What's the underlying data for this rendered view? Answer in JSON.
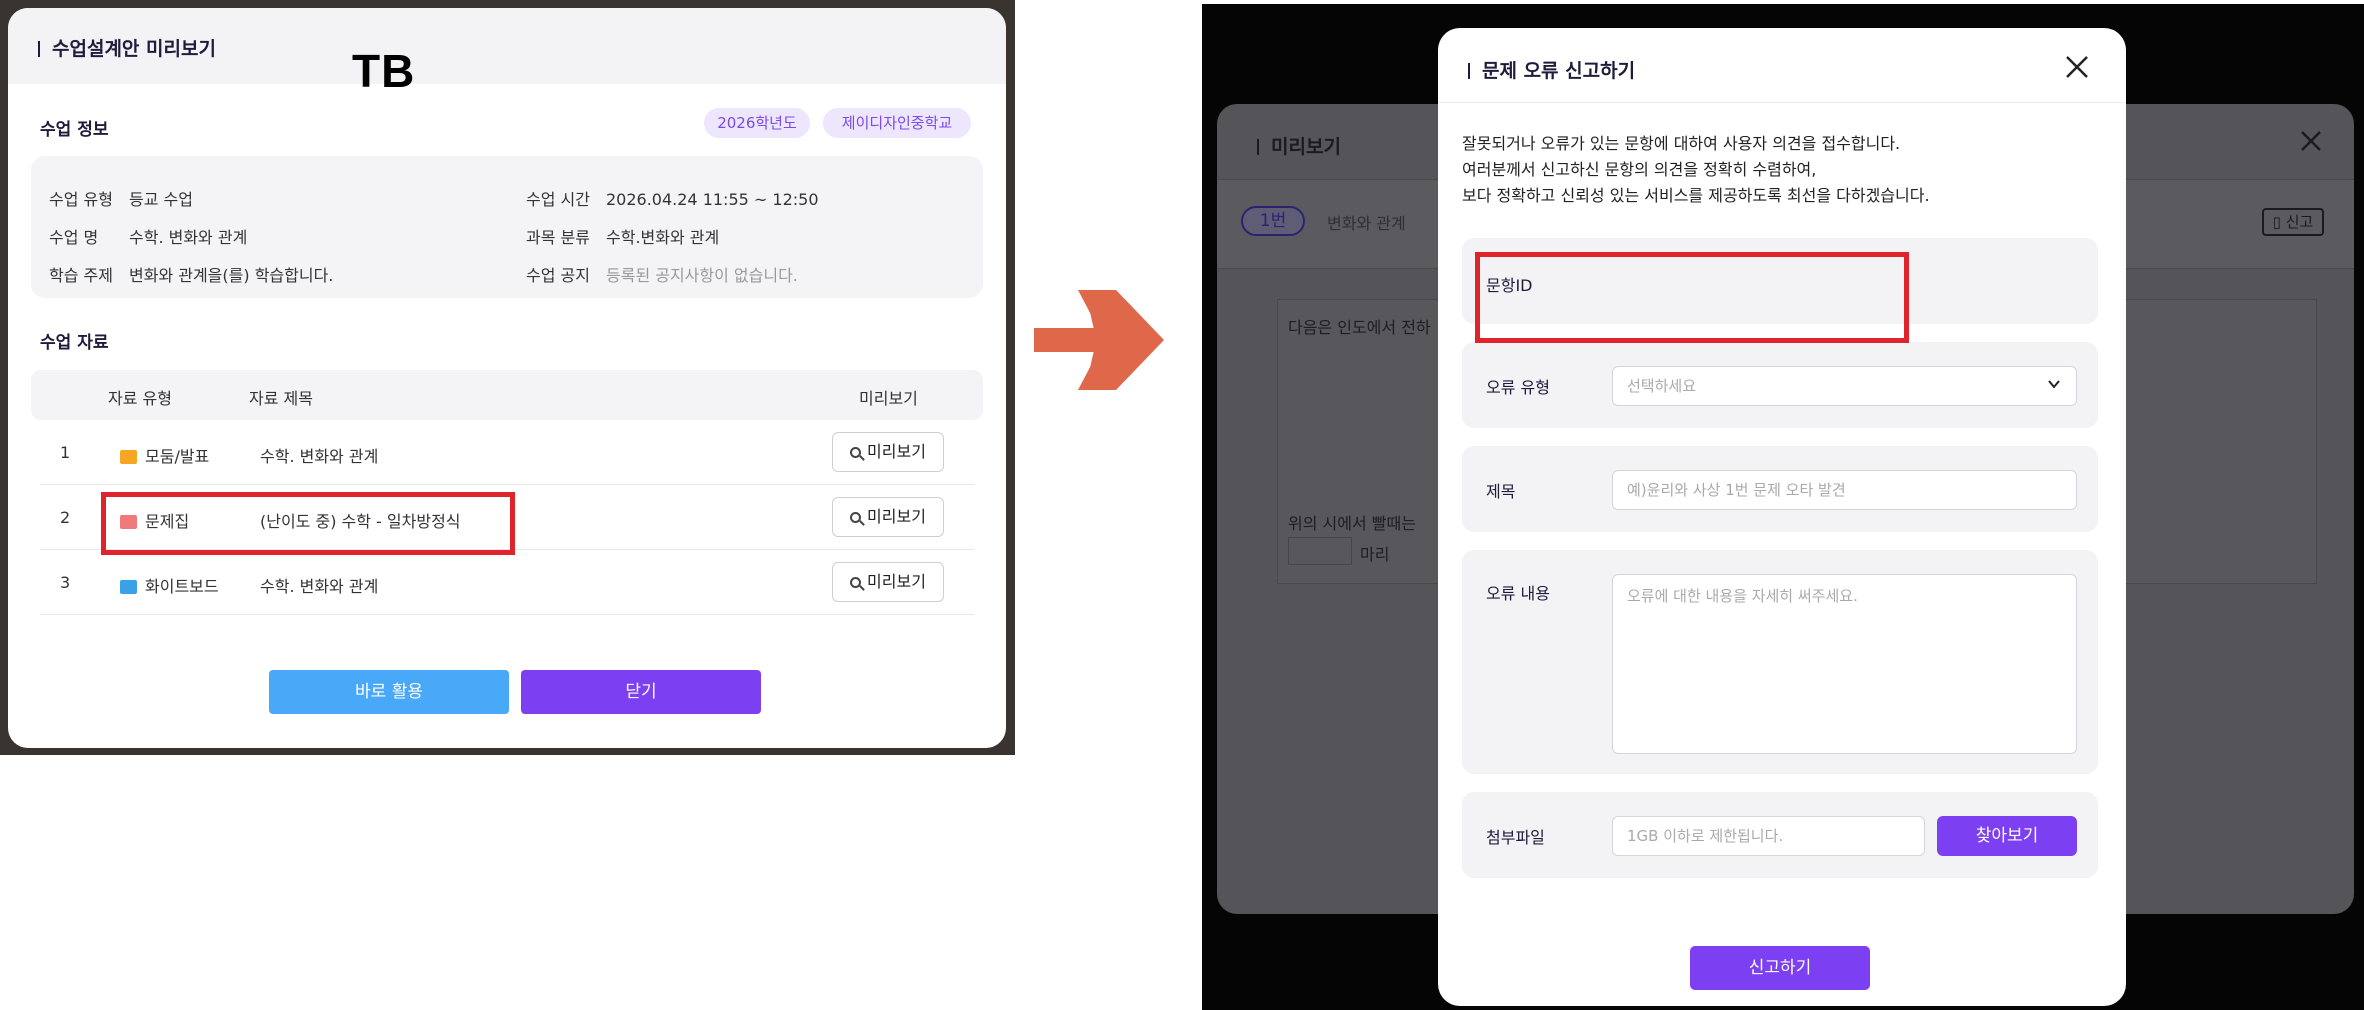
{
  "colors": {
    "accent_purple": "#7c3ff2",
    "accent_blue": "#4aa8f8",
    "tag_bg": "#ede6fc",
    "tag_text": "#7a4be8",
    "highlight_red": "#e0242c",
    "arrow": "#e0684a"
  },
  "left": {
    "title": "수업설계안 미리보기",
    "overlay_label": "TB",
    "section_info": "수업 정보",
    "tags": [
      "2026학년도",
      "제이디자인중학교"
    ],
    "info": {
      "type_k": "수업 유형",
      "type_v": "등교 수업",
      "time_k": "수업 시간",
      "time_v": "2026.04.24 11:55 ~ 12:50",
      "name_k": "수업 명",
      "name_v": "수학. 변화와 관계",
      "subject_k": "과목 분류",
      "subject_v": "수학.변화와 관계",
      "topic_k": "학습 주제",
      "topic_v": "변화와 관계을(를) 학습합니다.",
      "notice_k": "수업 공지",
      "notice_v": "등록된 공지사항이 없습니다."
    },
    "section_materials": "수업 자료",
    "table_headers": {
      "type": "자료 유형",
      "title": "자료 제목",
      "preview": "미리보기"
    },
    "rows": [
      {
        "num": "1",
        "type": "모둠/발표",
        "title": "수학. 변화와 관계",
        "icon": "group-icon",
        "btn": "미리보기"
      },
      {
        "num": "2",
        "type": "문제집",
        "title": "(난이도 중) 수학 - 일차방정식",
        "icon": "workbook-icon",
        "btn": "미리보기"
      },
      {
        "num": "3",
        "type": "화이트보드",
        "title": "수학. 변화와 관계",
        "icon": "whiteboard-icon",
        "btn": "미리보기"
      }
    ],
    "btn_use": "바로 활용",
    "btn_close": "닫기"
  },
  "right": {
    "bg": {
      "title": "미리보기",
      "pill": "1번",
      "tab_text": "변화와 관계",
      "report": "신고",
      "text1": "다음은 인도에서 전하",
      "text2": "위의 시에서 빨때는",
      "text3": "마리"
    },
    "modal": {
      "title": "문제 오류 신고하기",
      "desc": [
        "잘못되거나 오류가 있는 문항에 대하여 사용자 의견을 접수합니다.",
        "여러분께서 신고하신 문항의 의견을 정확히 수렴하여,",
        "보다 정확하고 신뢰성 있는 서비스를 제공하도록 최선을 다하겠습니다."
      ],
      "item_id_label": "문항ID",
      "error_type_label": "오류 유형",
      "error_type_placeholder": "선택하세요",
      "subject_label": "제목",
      "subject_placeholder": "예)윤리와 사상 1번 문제 오타 발견",
      "content_label": "오류 내용",
      "content_placeholder": "오류에 대한 내용을 자세히 써주세요.",
      "attach_label": "첨부파일",
      "attach_placeholder": "1GB 이하로 제한됩니다.",
      "find_btn": "찾아보기",
      "submit_btn": "신고하기"
    }
  }
}
